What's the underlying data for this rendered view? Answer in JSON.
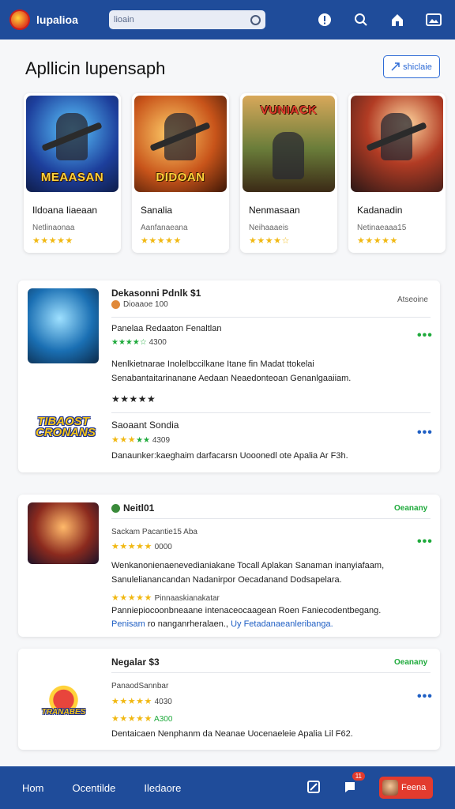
{
  "topbar": {
    "app_name": "lupalioa",
    "search_value": "lioain",
    "icons": [
      "info-icon",
      "search-icon",
      "home-icon",
      "image-icon"
    ]
  },
  "hero": {
    "title": "Apllicin lupensaph",
    "share_label": "shiclaie"
  },
  "featured": [
    {
      "thumb_text": "MEAASAN",
      "name": "Ildoana Iiaeaan",
      "sub": "Netlinaonaa",
      "stars": "★★★★★"
    },
    {
      "thumb_text": "DIDOAN",
      "name": "Sanalia",
      "sub": "Aanfanaeana",
      "stars": "★★★★★"
    },
    {
      "thumb_text": "VUNIACK",
      "name": "Nenmasaan",
      "sub": "Neihaaaeis",
      "stars": "★★★★☆"
    },
    {
      "thumb_text": "",
      "name": "Kadanadin",
      "sub": "Netinaeaaa15",
      "stars": "★★★★★"
    }
  ],
  "card1": {
    "title": "Dekasonni Pdnlk $1",
    "meta": "Dioaaoe 100",
    "right_label": "Atseoine",
    "row1": "Panelaa  Redaaton  Fenaltlan",
    "row1_rating": "4300",
    "desc_line1": "Nenlkietnarae  Inolelbccilkane  Itane fin Madat  ttokelai",
    "desc_line2": "Senabantaitarinanane Aedaan  Neaedonteoan Genanlgaaiiam.",
    "stars": "★★★★★",
    "item2_logo": "TIBAOST CRONANS",
    "item2_title": "Saoaant  Sondia",
    "item2_rating": "4309",
    "item2_desc": "Danaunker:kaeghaim darfacarsn  Uooonedl ote  Apalia  Ar F3h."
  },
  "card2": {
    "title": "Neitl01",
    "right_label": "Oeanany",
    "row1": "Sackam  Pacantie15 Aba",
    "row1_rating": "0000",
    "desc_line1": "Wenkanonienaenevedianiakane Tocall Aplakan  Sanaman  inanyiafaam,",
    "desc_line2": "Sanulelianancandan  Nadanirpor Oecadanand  Dodsapelara.",
    "row2": "Pinnaaskianakatar",
    "desc_line3": "Panniepiocoonbneaane intenaceocaagean  Roen  Faniecodentbegang.",
    "link_a": "Penisam",
    "link_mid": "ro nanganrheralaen.,",
    "link_b": "Uy Fetadanaeanleribanga."
  },
  "card3": {
    "title": "Negalar $3",
    "right_label": "Oeanany",
    "row1": "PanaodSannbar",
    "row1_rating": "4030",
    "row2_rating": "A300",
    "logo_text": "TRANABES",
    "desc": "Dentaicaen  Nenphanm da  Neanae Uocenaeleie  Apalia  Lil  F62."
  },
  "bottom_nav": {
    "items": [
      "Hom",
      "Ocentilde",
      "Iledaore"
    ],
    "badge": "11",
    "profile_label": "Feena"
  },
  "colors": {
    "primary": "#1f4c9a",
    "accent_red": "#e23b2e",
    "star": "#f1b812",
    "green": "#1faa3c",
    "link": "#1f5fc4"
  }
}
